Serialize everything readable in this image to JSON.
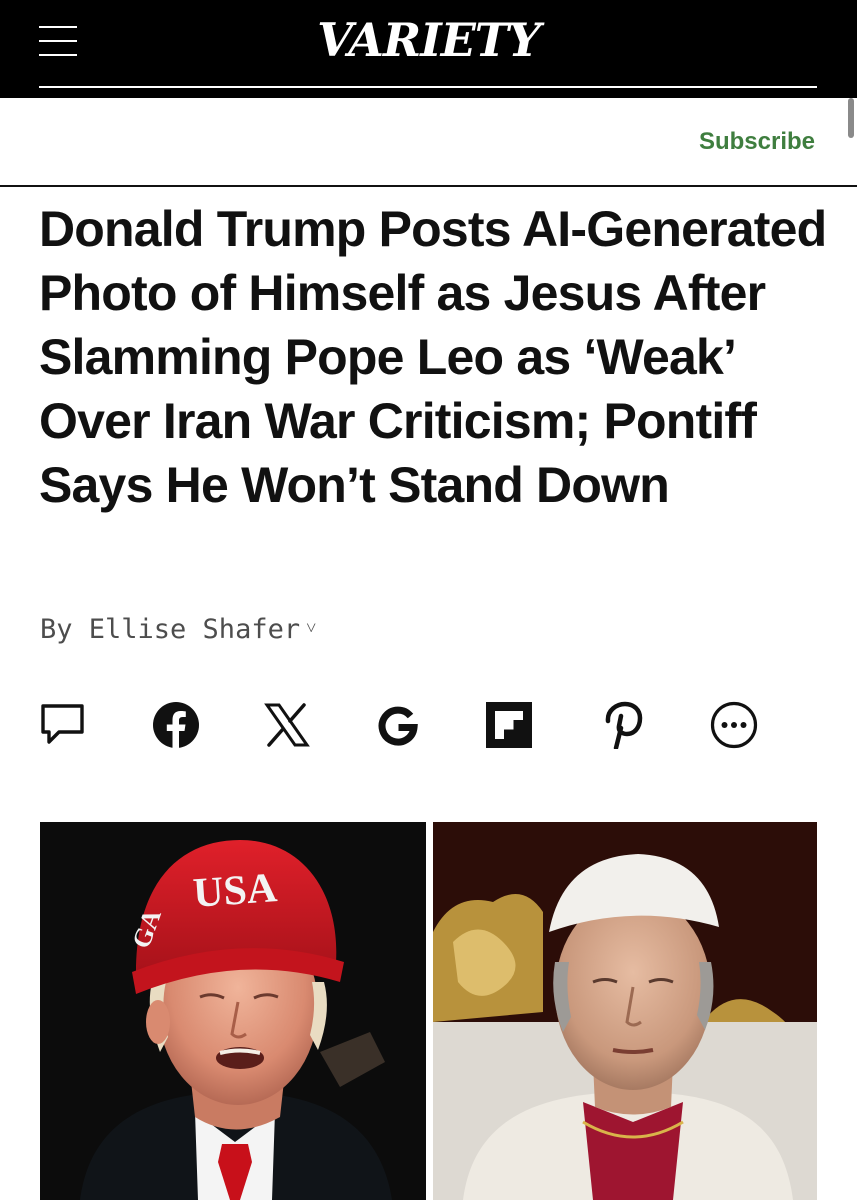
{
  "header": {
    "logo_text": "VARIETY",
    "menu_icon": "hamburger-menu-icon",
    "subscribe_label": "Subscribe",
    "accent_color": "#3f7e3f"
  },
  "article": {
    "headline": "Donald Trump Posts AI-Generated Photo of Himself as Jesus After Slamming Pope Leo as ‘Weak’ Over Iran War Criticism; Pontiff Says He Won’t Stand Down",
    "byline": "By Ellise Shafer"
  },
  "share_icons": [
    "comment-icon",
    "facebook-icon",
    "x-icon",
    "google-icon",
    "flipboard-icon",
    "pinterest-icon",
    "more-icon"
  ],
  "photos": {
    "left_cap_text": "USA",
    "left_cap_side_text": "GA",
    "left_icon": "photo-trump",
    "right_icon": "photo-pope"
  }
}
